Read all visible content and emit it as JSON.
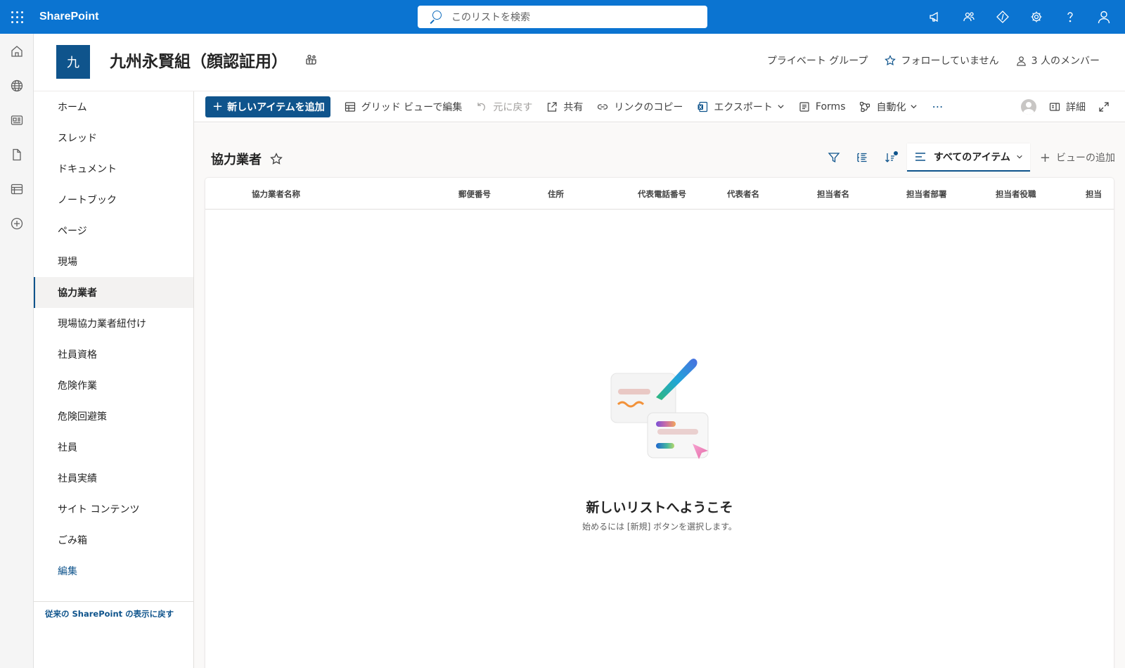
{
  "suite": {
    "brand": "SharePoint",
    "search_placeholder": "このリストを検索",
    "icons": [
      "megaphone-icon",
      "teams-icon",
      "diamond-code-icon",
      "gear-icon",
      "help-icon",
      "user-icon"
    ]
  },
  "site": {
    "logo_letter": "九",
    "title": "九州永賢組（顔認証用）",
    "privacy": "プライベート グループ",
    "follow": "フォローしていません",
    "members": "3 人のメンバー"
  },
  "nav": {
    "items": [
      {
        "label": "ホーム"
      },
      {
        "label": "スレッド"
      },
      {
        "label": "ドキュメント"
      },
      {
        "label": "ノートブック"
      },
      {
        "label": "ページ"
      },
      {
        "label": "現場"
      },
      {
        "label": "協力業者"
      },
      {
        "label": "現場協力業者紐付け"
      },
      {
        "label": "社員資格"
      },
      {
        "label": "危険作業"
      },
      {
        "label": "危険回避策"
      },
      {
        "label": "社員"
      },
      {
        "label": "社員実績"
      },
      {
        "label": "サイト コンテンツ"
      },
      {
        "label": "ごみ箱"
      },
      {
        "label": "編集"
      }
    ],
    "classic_link": "従来の SharePoint の表示に戻す"
  },
  "commandbar": {
    "new_item": "新しいアイテムを追加",
    "grid_edit": "グリッド ビューで編集",
    "undo": "元に戻す",
    "share": "共有",
    "copy_link": "リンクのコピー",
    "export": "エクスポート",
    "forms": "Forms",
    "automate": "自動化",
    "more": "⋯",
    "details": "詳細"
  },
  "list": {
    "title": "協力業者",
    "view_name": "すべてのアイテム",
    "add_view": "ビューの追加",
    "columns": [
      "協力業者名称",
      "郵便番号",
      "住所",
      "代表電話番号",
      "代表者名",
      "担当者名",
      "担当者部署",
      "担当者役職",
      "担当"
    ],
    "empty_title": "新しいリストへようこそ",
    "empty_subtitle": "始めるには [新規] ボタンを選択します。"
  },
  "colors": {
    "suite_bar": "#0b74d1",
    "brand_dark": "#0f548c"
  }
}
